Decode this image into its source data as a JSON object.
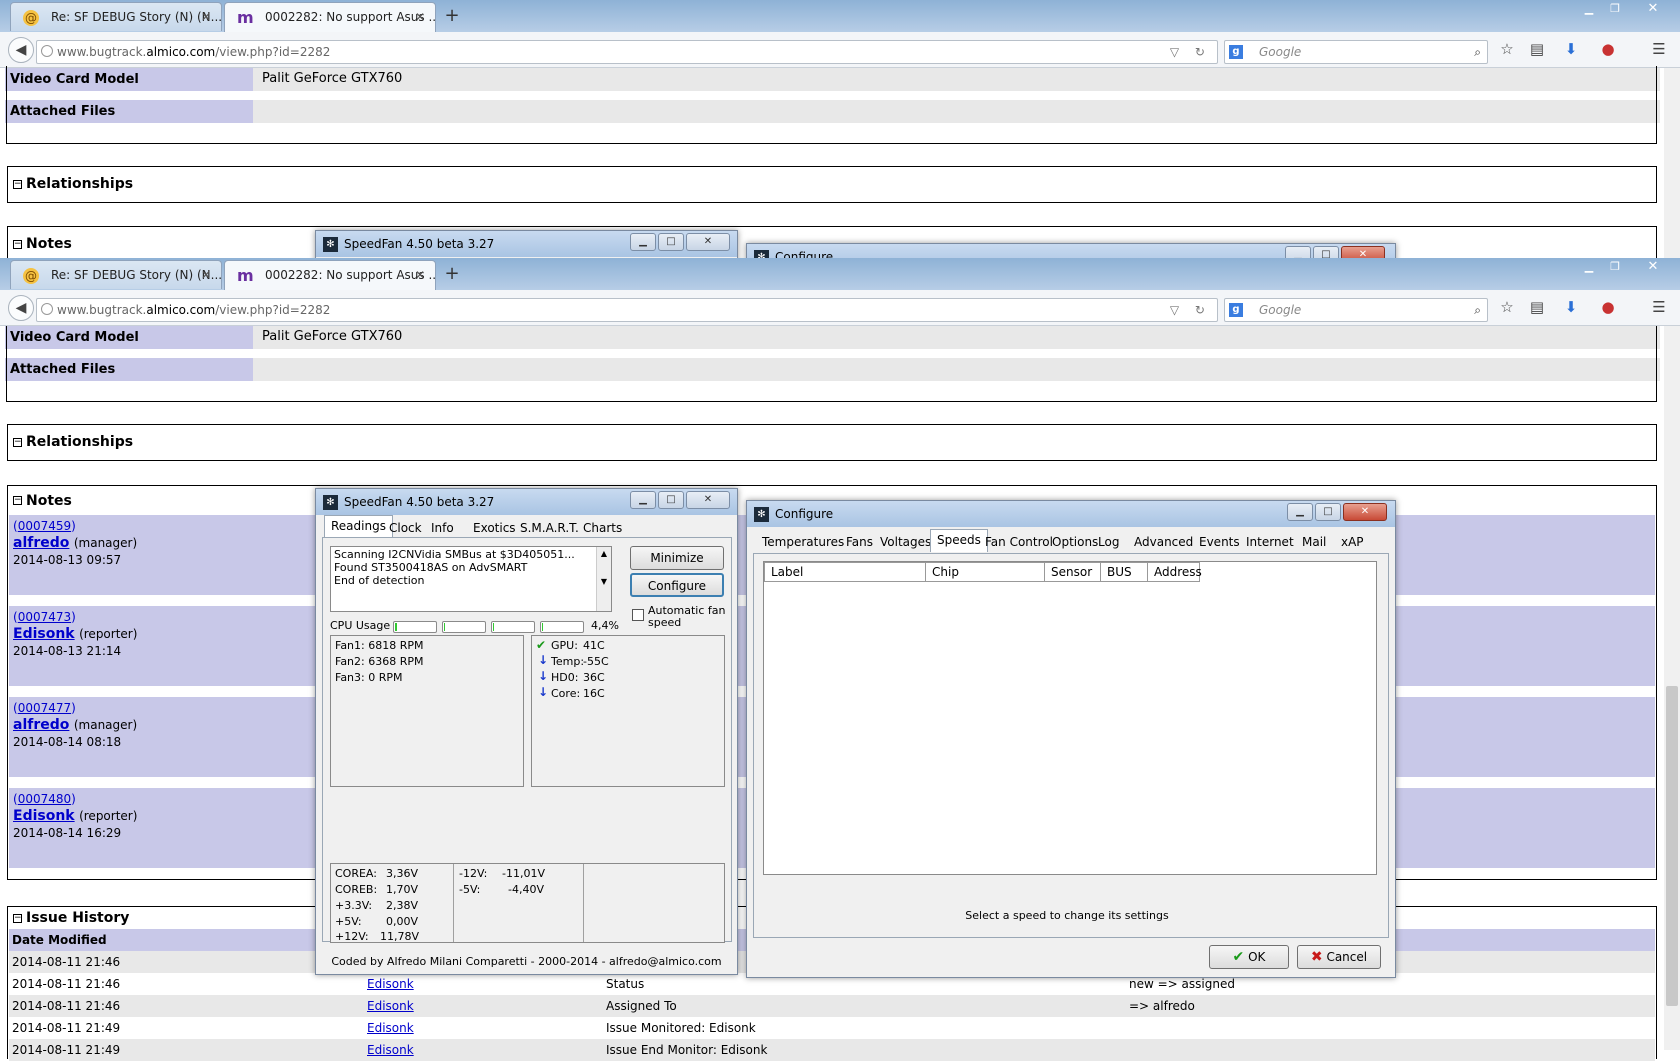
{
  "browser": {
    "tabs": [
      {
        "title": "Re: SF DEBUG Story (N) (N...",
        "icon": "@"
      },
      {
        "title": "0002282: No support Asus ...",
        "icon": "m"
      }
    ],
    "url_prefix": "www.bugtrack.",
    "url_domain": "almico.com",
    "url_path": "/view.php?id=2282",
    "search_placeholder": "Google"
  },
  "issue": {
    "video_card_label": "Video Card Model",
    "video_card_value": "Palit GeForce GTX760",
    "attached_files_label": "Attached Files",
    "relationships_label": "Relationships",
    "notes_label": "Notes",
    "notes": [
      {
        "id": "0007459",
        "user": "alfredo",
        "role": "(manager)",
        "date": "2014-08-13 09:57"
      },
      {
        "id": "0007473",
        "user": "Edisonk",
        "role": "(reporter)",
        "date": "2014-08-13 21:14"
      },
      {
        "id": "0007477",
        "user": "alfredo",
        "role": "(manager)",
        "date": "2014-08-14 08:18"
      },
      {
        "id": "0007480",
        "user": "Edisonk",
        "role": "(reporter)",
        "date": "2014-08-14 16:29"
      }
    ],
    "history_label": "Issue History",
    "history_header": "Date Modified",
    "history": [
      {
        "date": "2014-08-11 21:46",
        "user": "",
        "field": "",
        "change": ""
      },
      {
        "date": "2014-08-11 21:46",
        "user": "Edisonk",
        "field": "Status",
        "change": "new => assigned"
      },
      {
        "date": "2014-08-11 21:46",
        "user": "Edisonk",
        "field": "Assigned To",
        "change": "=> alfredo"
      },
      {
        "date": "2014-08-11 21:49",
        "user": "Edisonk",
        "field": "Issue Monitored: Edisonk",
        "change": ""
      },
      {
        "date": "2014-08-11 21:49",
        "user": "Edisonk",
        "field": "Issue End Monitor: Edisonk",
        "change": ""
      }
    ]
  },
  "speedfan": {
    "title": "SpeedFan 4.50 beta 3.27",
    "tabs": [
      "Readings",
      "Clock",
      "Info",
      "Exotics",
      "S.M.A.R.T.",
      "Charts"
    ],
    "log": [
      "Scanning I2CNVidia SMBus at $3D405051...",
      "Found ST3500418AS on AdvSMART",
      "End of detection"
    ],
    "minimize_label": "Minimize",
    "configure_label": "Configure",
    "auto_fan_label": "Automatic fan speed",
    "cpu_usage_label": "CPU Usage",
    "cpu_usage_value": "4,4%",
    "cpu_meter_levels": [
      0.04,
      0.02,
      0.03,
      0.02
    ],
    "fans": [
      "Fan1: 6818 RPM",
      "Fan2: 6368 RPM",
      "Fan3: 0 RPM"
    ],
    "temps": [
      {
        "label": "GPU:",
        "value": "41C",
        "icon": "check-icon"
      },
      {
        "label": "Temp:",
        "value": "-55C",
        "icon": "arrow-down-icon"
      },
      {
        "label": "HD0:",
        "value": "36C",
        "icon": "arrow-down-icon"
      },
      {
        "label": "Core:",
        "value": "16C",
        "icon": "arrow-down-icon"
      }
    ],
    "volts_left": [
      {
        "label": "COREA:",
        "value": "3,36V"
      },
      {
        "label": "COREB:",
        "value": "1,70V"
      },
      {
        "label": "+3.3V:",
        "value": "2,38V"
      },
      {
        "label": "+5V:",
        "value": "0,00V"
      },
      {
        "label": "+12V:",
        "value": "11,78V"
      }
    ],
    "volts_right": [
      {
        "label": "-12V:",
        "value": "-11,01V"
      },
      {
        "label": "-5V:",
        "value": "-4,40V"
      }
    ],
    "footer": "Coded by Alfredo Milani Comparetti - 2000-2014 - alfredo@almico.com"
  },
  "configure": {
    "title": "Configure",
    "tabs": [
      "Temperatures",
      "Fans",
      "Voltages",
      "Speeds",
      "Fan Control",
      "Options",
      "Log",
      "Advanced",
      "Events",
      "Internet",
      "Mail",
      "xAP"
    ],
    "selected_tab": "Speeds",
    "columns": [
      "Label",
      "Chip",
      "Sensor",
      "BUS",
      "Address"
    ],
    "hint": "Select a speed to change its settings",
    "ok_label": "OK",
    "cancel_label": "Cancel"
  }
}
